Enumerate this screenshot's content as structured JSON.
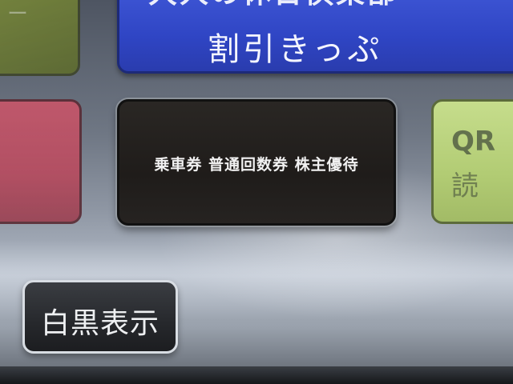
{
  "top_left_tile": {
    "text": "ー"
  },
  "discount_tile": {
    "line1": "大人の休日倶楽部",
    "line2": "割引きっぷ",
    "color": "#2f45c4"
  },
  "ticket_tile": {
    "label": "乗車券 普通回数券 株主優待",
    "color": "#1f1c1a"
  },
  "qr_tile": {
    "line1": "QR",
    "line2": "読",
    "color": "#b2cc74"
  },
  "left_red_tile": {
    "color": "#b84a5e"
  },
  "contrast_button": {
    "label": "白黒表示"
  }
}
